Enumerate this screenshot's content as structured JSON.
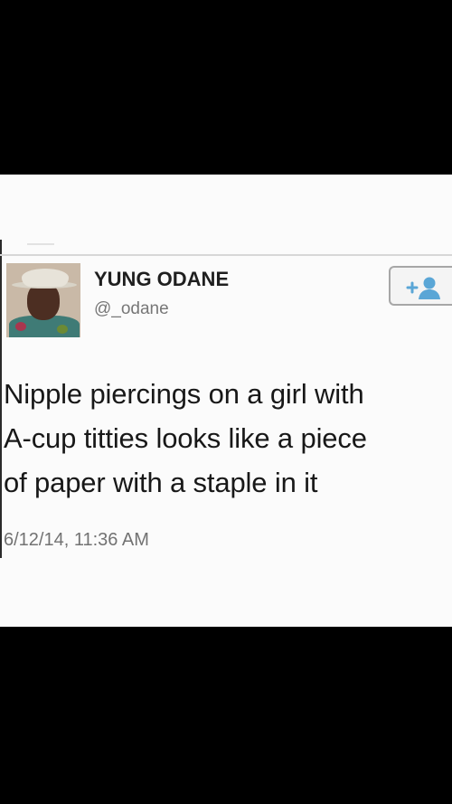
{
  "tweet": {
    "display_name": "YUNG ODANE",
    "handle": "@_odane",
    "text": "Nipple piercings on a girl with\nA-cup titties looks like a piece\nof paper with a staple in it",
    "timestamp": "6/12/14, 11:36 AM",
    "avatar_icon": "profile-photo-icon",
    "follow_icon": "follow-user-icon"
  },
  "colors": {
    "background": "#000000",
    "panel": "#fbfbfb",
    "name": "#1f1f1f",
    "secondary_text": "#777777",
    "follow_blue": "#5aa6d6"
  }
}
